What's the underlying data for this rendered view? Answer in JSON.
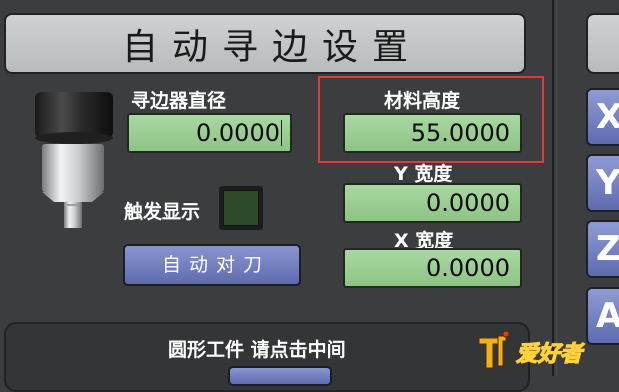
{
  "title": "自动寻边设置",
  "left": {
    "diameter_label": "寻边器直径",
    "diameter_value": "0.0000",
    "trigger_label": "触发显示",
    "auto_tool_button": "自动对刀"
  },
  "right": {
    "material_height_label": "材料高度",
    "material_height_value": "55.0000",
    "y_width_label": "Y 宽度",
    "y_width_value": "0.0000",
    "x_width_label": "X 宽度",
    "x_width_value": "0.0000"
  },
  "bottom": {
    "round_part_label": "圆形工件 请点击中间"
  },
  "axis_buttons": [
    "X",
    "Y",
    "Z",
    "A"
  ],
  "watermark": {
    "text": "爱好者"
  },
  "colors": {
    "background": "#3b3d3e",
    "field_green": "#a3d39c",
    "button_blue": "#7380c2",
    "highlight_red": "#e23a3a"
  }
}
